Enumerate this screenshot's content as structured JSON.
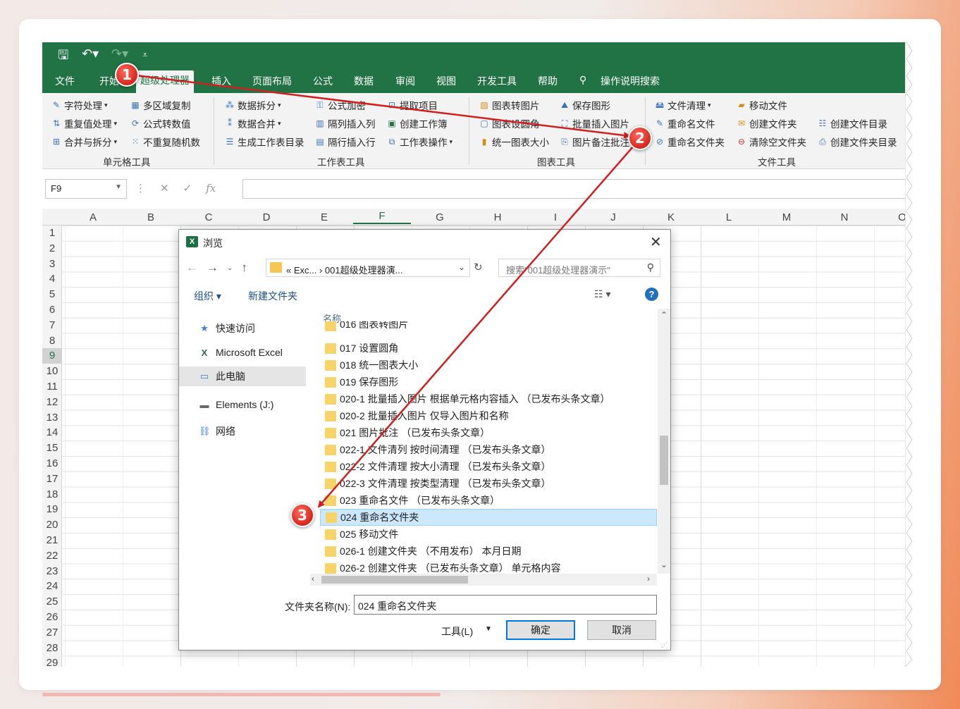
{
  "qat": {
    "save_icon": "save-icon",
    "undo_icon": "undo-icon",
    "redo_icon": "redo-icon",
    "customize_icon": "customize-icon"
  },
  "tabs": [
    "文件",
    "开始",
    "超级处理器",
    "插入",
    "页面布局",
    "公式",
    "数据",
    "审阅",
    "视图",
    "开发工具",
    "帮助",
    "操作说明搜索"
  ],
  "ribbon": {
    "cell_tools": {
      "label": "单元格工具",
      "items": [
        "字符处理",
        "多区域复制",
        "重复值处理",
        "公式转数值",
        "合并与拆分",
        "不重复随机数"
      ]
    },
    "sheet_tools": {
      "label": "工作表工具",
      "items": [
        "数据拆分",
        "公式加密",
        "提取项目",
        "数据合并",
        "隔列插入列",
        "创建工作簿",
        "生成工作表目录",
        "隔行插入行",
        "工作表操作"
      ]
    },
    "chart_tools": {
      "label": "图表工具",
      "items": [
        "图表转图片",
        "保存图形",
        "图表设圆角",
        "批量插入图片",
        "统一图表大小",
        "图片备注批注"
      ]
    },
    "file_tools": {
      "label": "文件工具",
      "items": [
        "文件清理",
        "移动文件",
        "重命名文件",
        "创建文件夹",
        "创建文件目录",
        "重命名文件夹",
        "清除空文件夹",
        "创建文件夹目录"
      ]
    }
  },
  "formula_bar": {
    "name_box": "F9",
    "fx": "fx"
  },
  "columns": [
    "A",
    "B",
    "C",
    "D",
    "E",
    "F",
    "G",
    "H",
    "I",
    "J",
    "K",
    "L",
    "M",
    "N",
    "O"
  ],
  "rows": [
    "1",
    "2",
    "3",
    "4",
    "5",
    "6",
    "7",
    "8",
    "9",
    "10",
    "11",
    "12",
    "13",
    "14",
    "15",
    "16",
    "17",
    "18",
    "19",
    "20",
    "21",
    "22",
    "23",
    "24",
    "25",
    "26",
    "27",
    "28",
    "29"
  ],
  "selected_cell": {
    "column": "F",
    "row": "9"
  },
  "dialog": {
    "title": "浏览",
    "address": "«  Exc...  ›  001超级处理器演...",
    "search_placeholder": "搜索\"001超级处理器演示\"",
    "organize": "组织 ▾",
    "new_folder": "新建文件夹",
    "tree": [
      {
        "label": "快速访问",
        "icon": "star-icon"
      },
      {
        "label": "Microsoft Excel",
        "icon": "excel-icon"
      },
      {
        "label": "此电脑",
        "icon": "computer-icon"
      },
      {
        "label": "Elements (J:)",
        "icon": "drive-icon"
      },
      {
        "label": "网络",
        "icon": "network-icon"
      }
    ],
    "column_header": "名称",
    "files": [
      "016 图表转图片",
      "017 设置圆角",
      "018 统一图表大小",
      "019 保存图形",
      "020-1 批量插入图片 根据单元格内容插入 （已发布头条文章）",
      "020-2 批量插入图片 仅导入图片和名称",
      "021 图片批注 （已发布头条文章）",
      "022-1 文件清列 按时间清理 （已发布头条文章）",
      "022-2 文件清理 按大小清理 （已发布头条文章）",
      "022-3 文件清理 按类型清理 （已发布头条文章）",
      "023 重命名文件 （已发布头条文章）",
      "024 重命名文件夹",
      "025 移动文件",
      "026-1 创建文件夹 （不用发布） 本月日期",
      "026-2 创建文件夹 （已发布头条文章） 单元格内容"
    ],
    "selected_index": 11,
    "folder_name_label": "文件夹名称(N):",
    "folder_name_value": "024 重命名文件夹",
    "tools": "工具(L)",
    "ok": "确定",
    "cancel": "取消"
  },
  "annotations": {
    "step1": "1",
    "step2": "2",
    "step3": "3",
    "arrow_color": "#d11f1f"
  }
}
